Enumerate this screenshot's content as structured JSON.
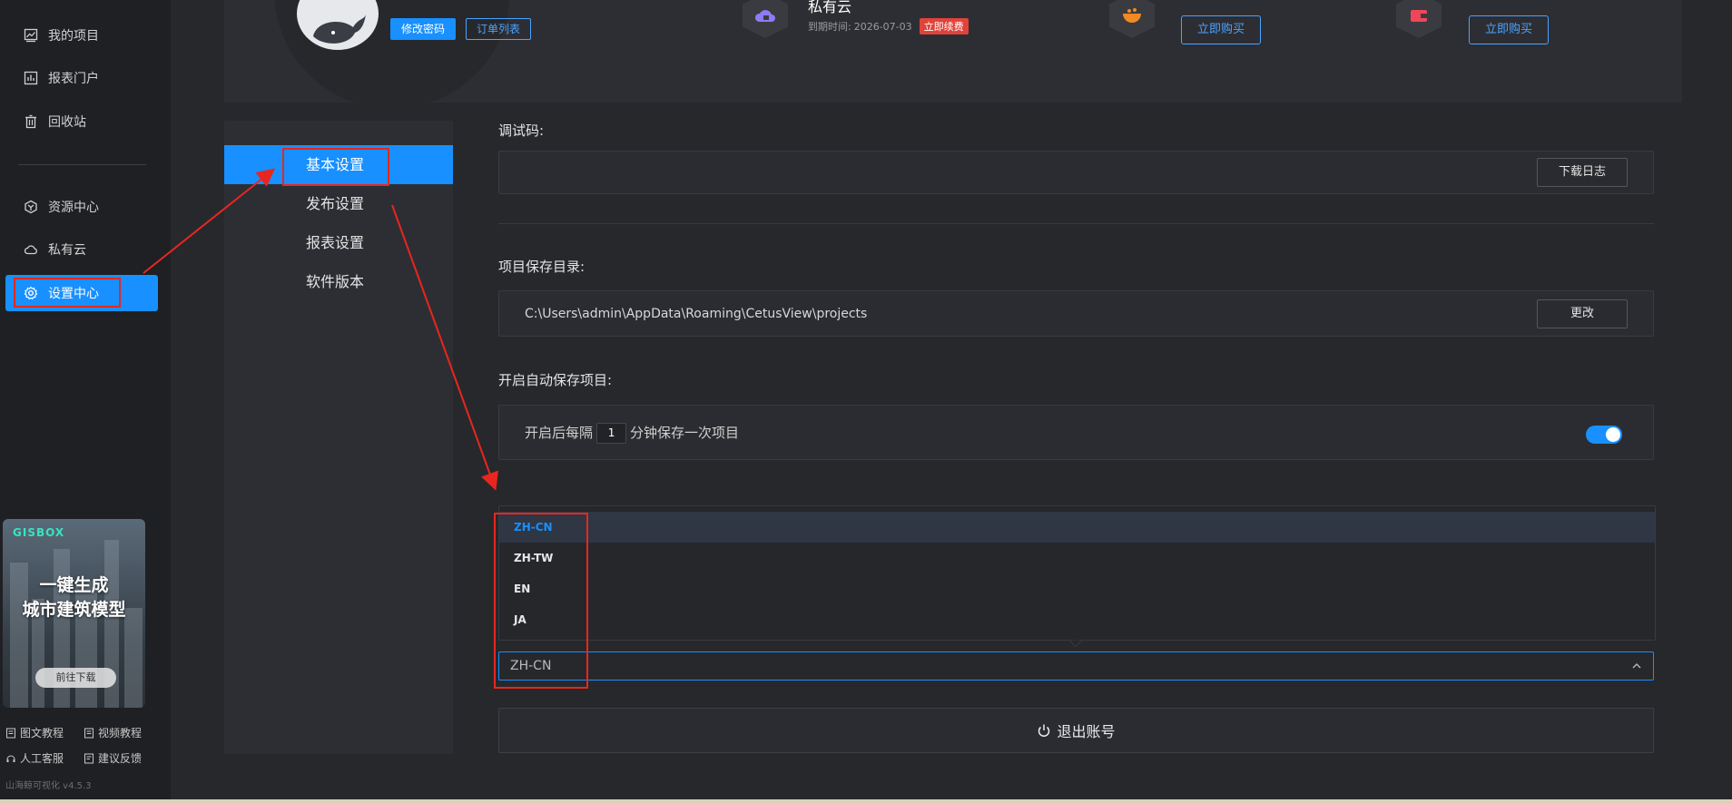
{
  "sidebar": {
    "items": [
      {
        "label": "我的项目",
        "icon": "chart-icon"
      },
      {
        "label": "报表门户",
        "icon": "report-icon"
      },
      {
        "label": "回收站",
        "icon": "trash-icon"
      },
      {
        "label": "资源中心",
        "icon": "resource-icon"
      },
      {
        "label": "私有云",
        "icon": "cloud-icon"
      },
      {
        "label": "设置中心",
        "icon": "gear-icon",
        "active": true
      }
    ],
    "ad": {
      "logo": "GISBOX",
      "title_line1": "一键生成",
      "title_line2": "城市建筑模型",
      "button": "前往下载"
    },
    "footer_links": [
      "图文教程",
      "视频教程",
      "人工客服",
      "建议反馈"
    ],
    "version": "山海鲸可视化 v4.5.3"
  },
  "topcard": {
    "change_password": "修改密码",
    "order_list": "订单列表",
    "private_cloud_title": "私有云",
    "expire_label": "到期时间:",
    "expire_date": "2026-07-03",
    "renew": "立即续费",
    "buy_now_1": "立即购买",
    "buy_now_2": "立即购买"
  },
  "subnav": {
    "items": [
      "基本设置",
      "发布设置",
      "报表设置",
      "软件版本"
    ]
  },
  "settings": {
    "debug_label": "调试码:",
    "download_log": "下载日志",
    "save_dir_label": "项目保存目录:",
    "save_dir_path": "C:\\Users\\admin\\AppData\\Roaming\\CetusView\\projects",
    "change": "更改",
    "autosave_label": "开启自动保存项目:",
    "autosave_prefix": "开启后每隔",
    "autosave_minutes": "1",
    "autosave_suffix": "分钟保存一次项目",
    "autosave_enabled": true
  },
  "language": {
    "options": [
      "ZH-CN",
      "ZH-TW",
      "EN",
      "JA"
    ],
    "selected": "ZH-CN"
  },
  "logout": "退出账号",
  "colors": {
    "accent": "#1890ff",
    "annotation": "#e8261f"
  }
}
